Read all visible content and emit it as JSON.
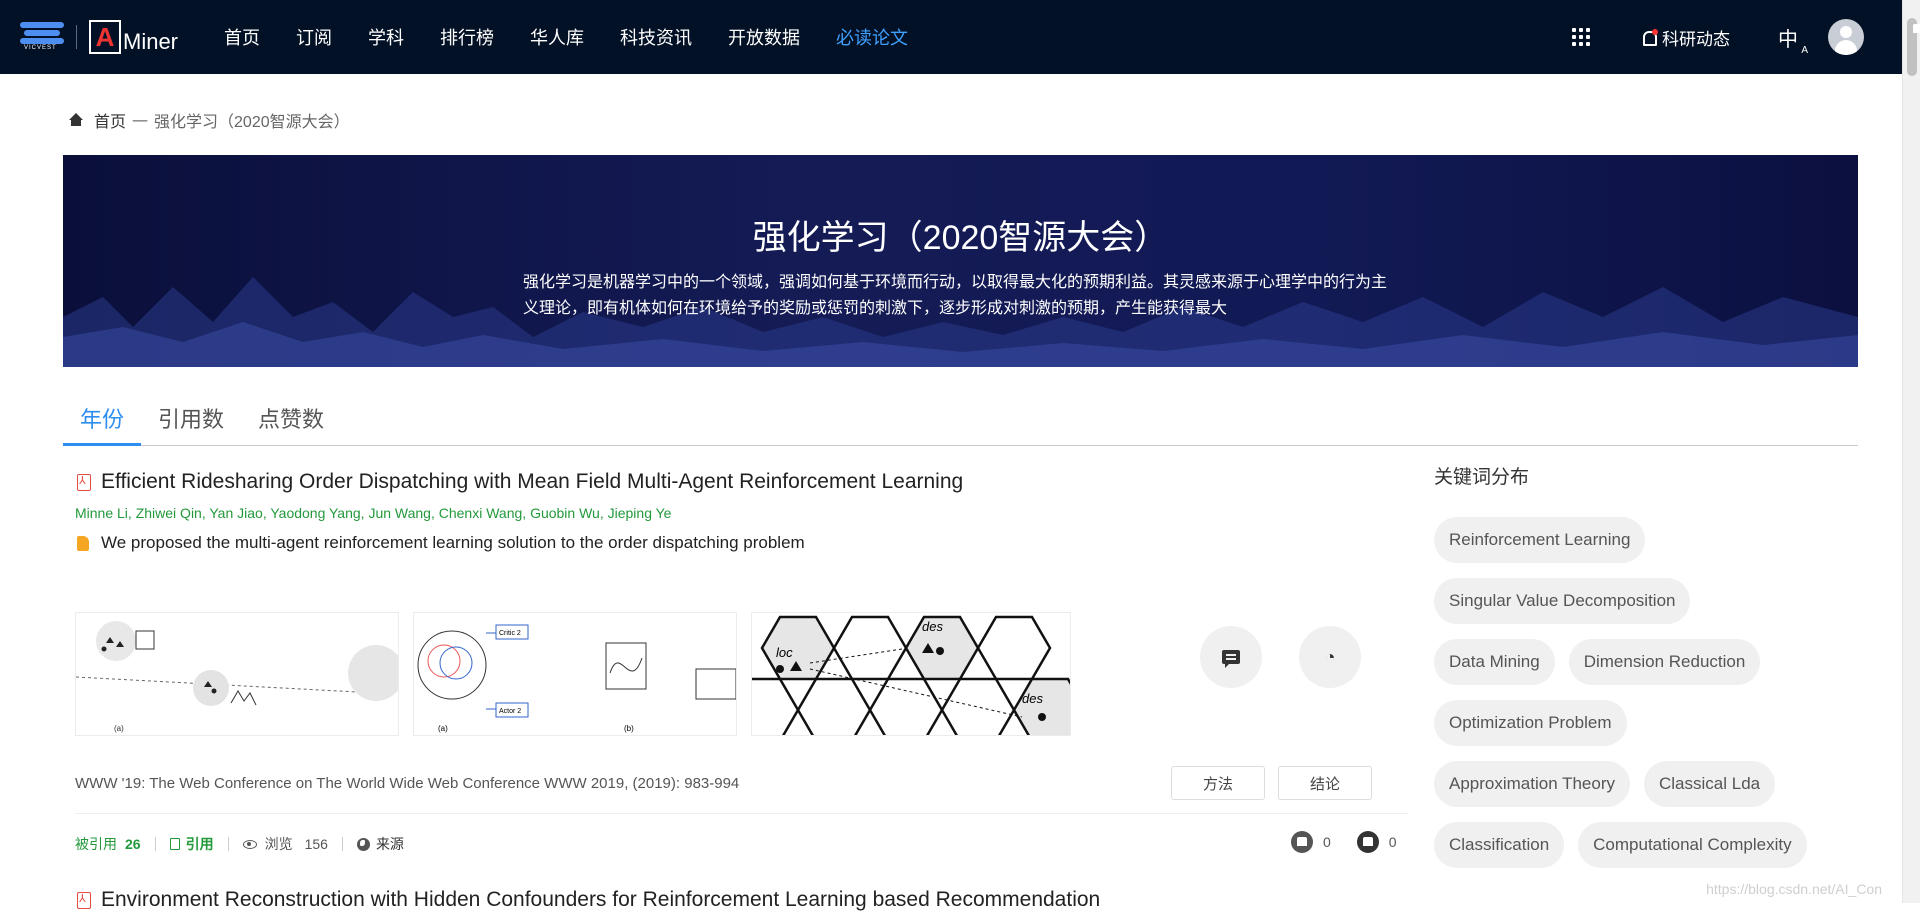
{
  "nav": {
    "logo_left": "VICVEST",
    "logo_brand": "Miner",
    "items": [
      "首页",
      "订阅",
      "学科",
      "排行榜",
      "华人库",
      "科技资讯",
      "开放数据",
      "必读论文"
    ],
    "active_index": 7,
    "notification_label": "科研动态",
    "lang_label": "中",
    "lang_sub": "A"
  },
  "breadcrumb": {
    "home": "首页",
    "separator": "一",
    "current": "强化学习（2020智源大会）"
  },
  "banner": {
    "title": "强化学习（2020智源大会）",
    "description": "强化学习是机器学习中的一个领域，强调如何基于环境而行动，以取得最大化的预期利益。其灵感来源于心理学中的行为主义理论，即有机体如何在环境给予的奖励或惩罚的刺激下，逐步形成对刺激的预期，产生能获得最大"
  },
  "tabs": [
    "年份",
    "引用数",
    "点赞数"
  ],
  "active_tab": 0,
  "paper": {
    "title": "Efficient Ridesharing Order Dispatching with Mean Field Multi-Agent Reinforcement Learning",
    "authors": [
      "Minne Li",
      "Zhiwei Qin",
      "Yan Jiao",
      "Yaodong Yang",
      "Jun Wang",
      "Chenxi Wang",
      "Guobin Wu",
      "Jieping Ye"
    ],
    "summary": "We proposed the multi-agent reinforcement learning solution to the order dispatching problem",
    "venue": "WWW '19: The Web Conference on The World Wide Web Conference WWW 2019, (2019): 983-994",
    "method_btn": "方法",
    "conclusion_btn": "结论",
    "cited_label": "被引用",
    "cited_count": "26",
    "cite_label": "引用",
    "views_label": "浏览",
    "views_count": "156",
    "source_label": "来源",
    "likes": "0",
    "dislikes": "0"
  },
  "next_paper_title": "Environment Reconstruction with Hidden Confounders for Reinforcement Learning based Recommendation",
  "sidebar": {
    "title": "关键词分布",
    "tags": [
      "Reinforcement Learning",
      "Singular Value Decomposition",
      "Data Mining",
      "Dimension Reduction",
      "Optimization Problem",
      "Approximation Theory",
      "Classical Lda",
      "Classification",
      "Computational Complexity"
    ]
  },
  "watermark": "https://blog.csdn.net/AI_Con",
  "colors": {
    "nav_bg": "#021126",
    "accent": "#2b8ef0",
    "green": "#23993c"
  }
}
